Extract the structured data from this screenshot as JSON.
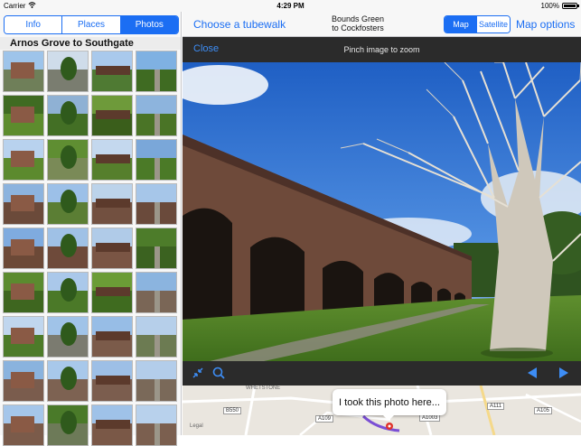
{
  "status_bar": {
    "carrier": "Carrier",
    "time": "4:29 PM",
    "battery": "100%"
  },
  "left_panel": {
    "tabs": [
      {
        "label": "Info",
        "active": false
      },
      {
        "label": "Places",
        "active": false
      },
      {
        "label": "Photos",
        "active": true
      }
    ],
    "section_title": "Arnos Grove to Southgate"
  },
  "nav_bar": {
    "choose_label": "Choose a tubewalk",
    "route_line1": "Bounds Green",
    "route_line2": "to Cockfosters",
    "map_type_options": [
      {
        "label": "Map",
        "active": true
      },
      {
        "label": "Satellite",
        "active": false
      }
    ],
    "map_options_label": "Map options"
  },
  "photo_viewer": {
    "close_label": "Close",
    "hint": "Pinch image to zoom"
  },
  "mini_map": {
    "callout": "I took this photo here...",
    "area_label": "WHETSTONE",
    "road_labels": [
      "B550",
      "A109",
      "A1003",
      "A111",
      "A105"
    ],
    "legal_label": "Legal"
  },
  "colors": {
    "accent": "#1b6ef3",
    "viewer_bar": "#2b2b2b"
  }
}
